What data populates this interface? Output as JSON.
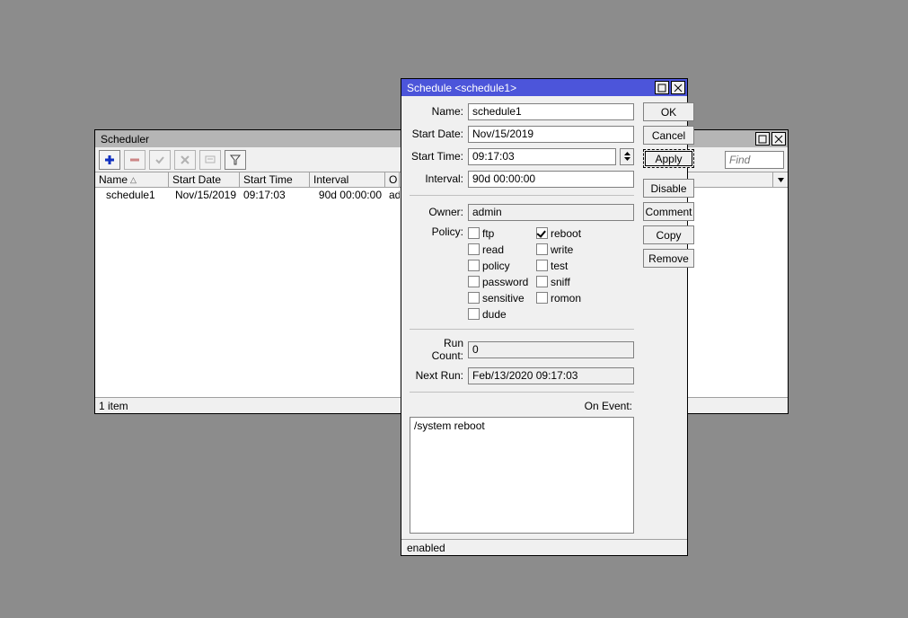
{
  "scheduler": {
    "title": "Scheduler",
    "find_placeholder": "Find",
    "columns": [
      "Name",
      "Start Date",
      "Start Time",
      "Interval",
      "Owner"
    ],
    "col_owner_trunc": "O",
    "sorted_column_index": 0,
    "rows": [
      {
        "name": "schedule1",
        "start_date": "Nov/15/2019",
        "start_time": "09:17:03",
        "interval": "90d 00:00:00",
        "owner_trunc": "ad"
      }
    ],
    "status": "1 item"
  },
  "dialog": {
    "title": "Schedule <schedule1>",
    "labels": {
      "name": "Name:",
      "start_date": "Start Date:",
      "start_time": "Start Time:",
      "interval": "Interval:",
      "owner": "Owner:",
      "policy": "Policy:",
      "run_count": "Run Count:",
      "next_run": "Next Run:",
      "on_event": "On Event:"
    },
    "values": {
      "name": "schedule1",
      "start_date": "Nov/15/2019",
      "start_time": "09:17:03",
      "interval": "90d 00:00:00",
      "owner": "admin",
      "run_count": "0",
      "next_run": "Feb/13/2020 09:17:03",
      "on_event": "/system reboot"
    },
    "policy": {
      "ftp": false,
      "reboot": true,
      "read": false,
      "write": false,
      "policy": false,
      "test": false,
      "password": false,
      "sniff": false,
      "sensitive": false,
      "romon": false,
      "dude": false
    },
    "policy_labels": {
      "ftp": "ftp",
      "reboot": "reboot",
      "read": "read",
      "write": "write",
      "policy": "policy",
      "test": "test",
      "password": "password",
      "sniff": "sniff",
      "sensitive": "sensitive",
      "romon": "romon",
      "dude": "dude"
    },
    "buttons": {
      "ok": "OK",
      "cancel": "Cancel",
      "apply": "Apply",
      "disable": "Disable",
      "comment": "Comment",
      "copy": "Copy",
      "remove": "Remove"
    },
    "status": "enabled"
  }
}
